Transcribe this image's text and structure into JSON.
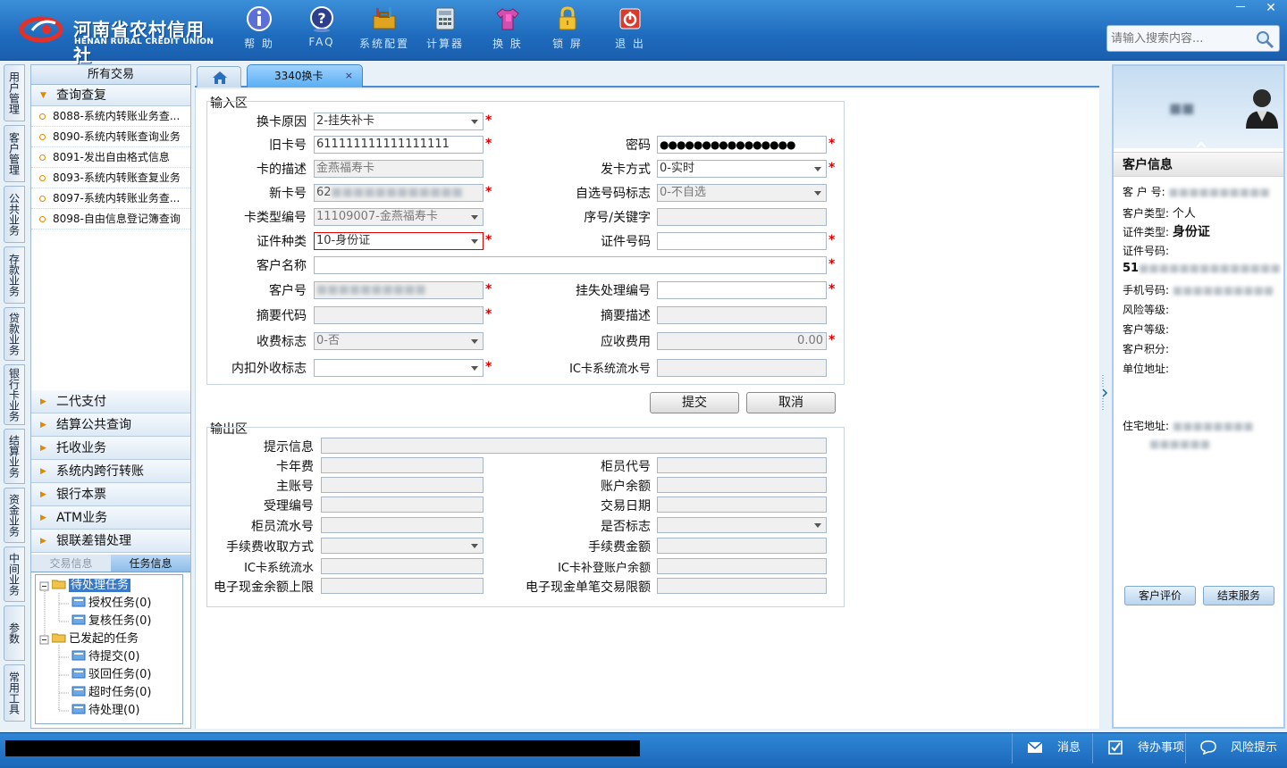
{
  "brand": {
    "name_cn": "河南省农村信用社",
    "name_en": "HENAN RURAL CREDIT UNION"
  },
  "toolbar": [
    {
      "label": "帮 助",
      "icon": "info-icon"
    },
    {
      "label": "FAQ",
      "icon": "help-icon"
    },
    {
      "label": "系统配置",
      "icon": "toolbox-icon"
    },
    {
      "label": "计算器",
      "icon": "calculator-icon"
    },
    {
      "label": "换 肤",
      "icon": "shirt-icon"
    },
    {
      "label": "锁 屏",
      "icon": "lock-icon"
    },
    {
      "label": "退 出",
      "icon": "power-icon"
    }
  ],
  "search": {
    "placeholder": "请输入搜索内容..."
  },
  "window": {
    "minimize": "－",
    "close": "✕"
  },
  "vertical_tabs": [
    "用户管理",
    "客户管理",
    "公共业务",
    "存款业务",
    "贷款业务",
    "银行卡业务",
    "结算业务",
    "资金业务",
    "中间业务",
    "参数",
    "常用工具"
  ],
  "left_panel": {
    "title": "所有交易",
    "open_group": "查询查复",
    "open_items": [
      "8088-系统内转账业务查...",
      "8090-系统内转账查询业务",
      "8091-发出自由格式信息",
      "8093-系统内转账查复业务",
      "8097-系统内转账业务查...",
      "8098-自由信息登记簿查询"
    ],
    "groups": [
      "二代支付",
      "结算公共查询",
      "托收业务",
      "系统内跨行转账",
      "银行本票",
      "ATM业务",
      "银联差错处理"
    ],
    "task_tabs": [
      "交易信息",
      "任务信息"
    ],
    "tree": {
      "pending": "待处理任务",
      "pending_children": [
        "授权任务(0)",
        "复核任务(0)"
      ],
      "initiated": "已发起的任务",
      "initiated_children": [
        "待提交(0)",
        "驳回任务(0)",
        "超时任务(0)",
        "待处理(0)"
      ]
    }
  },
  "tabs": {
    "home_icon": "home-icon",
    "current": "3340换卡",
    "close": "×"
  },
  "input_area": {
    "title": "输入区",
    "labels": {
      "reason": "换卡原因",
      "old_card": "旧卡号",
      "password": "密码",
      "card_desc": "卡的描述",
      "issue_method": "发卡方式",
      "new_card": "新卡号",
      "self_select": "自选号码标志",
      "card_type": "卡类型编号",
      "seq_key": "序号/关键字",
      "id_type": "证件种类",
      "id_no": "证件号码",
      "customer_name": "客户名称",
      "customer_no": "客户号",
      "loss_no": "挂失处理编号",
      "summary_code": "摘要代码",
      "summary_desc": "摘要描述",
      "fee_flag": "收费标志",
      "fee_due": "应收费用",
      "deduct_flag": "内扣外收标志",
      "ic_serial": "IC卡系统流水号"
    },
    "values": {
      "reason": "2-挂失补卡",
      "old_card": "611111111111111111",
      "password": "●●●●●●●●●●●●●●●●",
      "card_desc": "金燕福寿卡",
      "issue_method": "0-实时",
      "new_card_prefix": "62",
      "self_select": "0-不自选",
      "card_type": "11109007-金燕福寿卡",
      "id_type": "10-身份证",
      "fee_flag": "0-否",
      "fee_due": "0.00"
    },
    "buttons": {
      "submit": "提交",
      "cancel": "取消"
    }
  },
  "output_area": {
    "title": "输出区",
    "labels": {
      "hint": "提示信息",
      "card_fee": "卡年费",
      "teller_code": "柜员代号",
      "main_account": "主账号",
      "balance": "账户余额",
      "accept_no": "受理编号",
      "txn_date": "交易日期",
      "teller_serial": "柜员流水号",
      "yes_no_flag": "是否标志",
      "fee_method": "手续费收取方式",
      "fee_amount": "手续费金额",
      "ic_serial": "IC卡系统流水",
      "ic_account_balance": "IC卡补登账户余额",
      "ecash_limit": "电子现金余额上限",
      "ecash_single_limit": "电子现金单笔交易限额"
    }
  },
  "customer_info": {
    "title": "客户信息",
    "labels": {
      "customer_no": "客 户 号:",
      "customer_type": "客户类型:",
      "id_type": "证件类型:",
      "id_no": "证件号码:",
      "mobile": "手机号码:",
      "risk_level": "风险等级:",
      "customer_level": "客户等级:",
      "points": "客户积分:",
      "work_address": "单位地址:",
      "home_address": "住宅地址:"
    },
    "values": {
      "customer_type": "个人",
      "id_type": "身份证",
      "id_prefix": "51"
    },
    "buttons": {
      "rate": "客户评价",
      "end": "结束服务"
    }
  },
  "status_bar": [
    {
      "label": "消息",
      "icon": "mail-icon"
    },
    {
      "label": "待办事项",
      "icon": "checkbox-icon"
    },
    {
      "label": "风险提示",
      "icon": "chat-icon"
    }
  ]
}
